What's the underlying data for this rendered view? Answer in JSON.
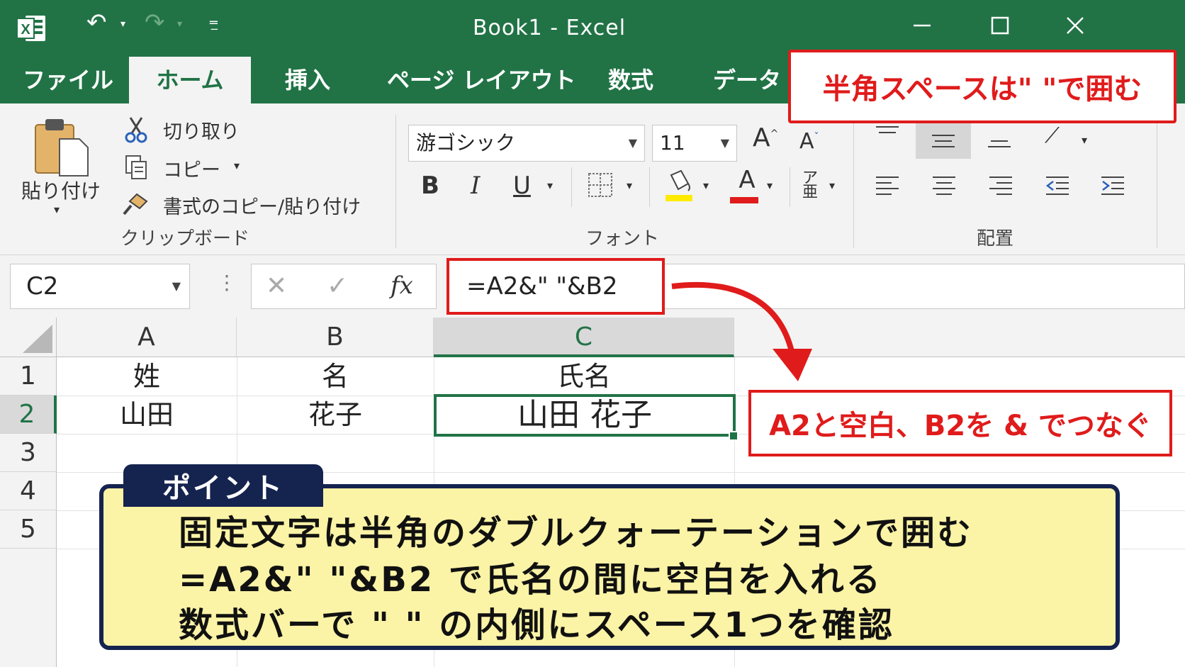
{
  "titlebar": {
    "title": "Book1  -  Excel",
    "icons": [
      "excel-logo",
      "undo-icon",
      "redo-icon",
      "customize-quick-access-icon",
      "minimize-icon",
      "maximize-icon",
      "close-icon"
    ]
  },
  "tabs": [
    "ファイル",
    "ホーム",
    "挿入",
    "ページ レイアウト",
    "数式",
    "データ"
  ],
  "active_tab": "ホーム",
  "ribbon": {
    "clipboard": {
      "paste": "貼り付け",
      "cut": "切り取り",
      "copy": "コピー",
      "format_painter": "書式のコピー/貼り付け",
      "label": "クリップボード"
    },
    "font": {
      "name": "游ゴシック",
      "size": "11",
      "bold": "B",
      "italic": "I",
      "underline": "U",
      "font_color": "A",
      "grow": "A",
      "shrink": "A",
      "label": "フォント"
    },
    "alignment": {
      "label": "配置"
    }
  },
  "formula_bar": {
    "name_box": "C2",
    "fx": "fx",
    "formula": "=A2&\" \"&B2"
  },
  "grid": {
    "columns": [
      "A",
      "B",
      "C"
    ],
    "selected_column": "C",
    "rows": [
      "1",
      "2",
      "3",
      "4",
      "5"
    ],
    "selected_row": "2",
    "cells": {
      "A1": "姓",
      "B1": "名",
      "C1": "氏名",
      "A2": "山田",
      "B2": "花子",
      "C2": "山田 花子"
    }
  },
  "callouts": {
    "top": "半角スペースは\" \"で囲む",
    "right": "A2と空白、B2を & でつなぐ"
  },
  "point": {
    "tag": "ポイント",
    "lines": [
      "固定文字は半角のダブルクォーテーションで囲む",
      "=A2&\" \"&B2 で氏名の間に空白を入れる",
      "数式バーで \" \" の内側にスペース1つを確認"
    ]
  },
  "colors": {
    "excel_green": "#217346",
    "callout_red": "#e01b1b",
    "point_navy": "#15234f",
    "point_yellow": "#fbf3a6"
  }
}
